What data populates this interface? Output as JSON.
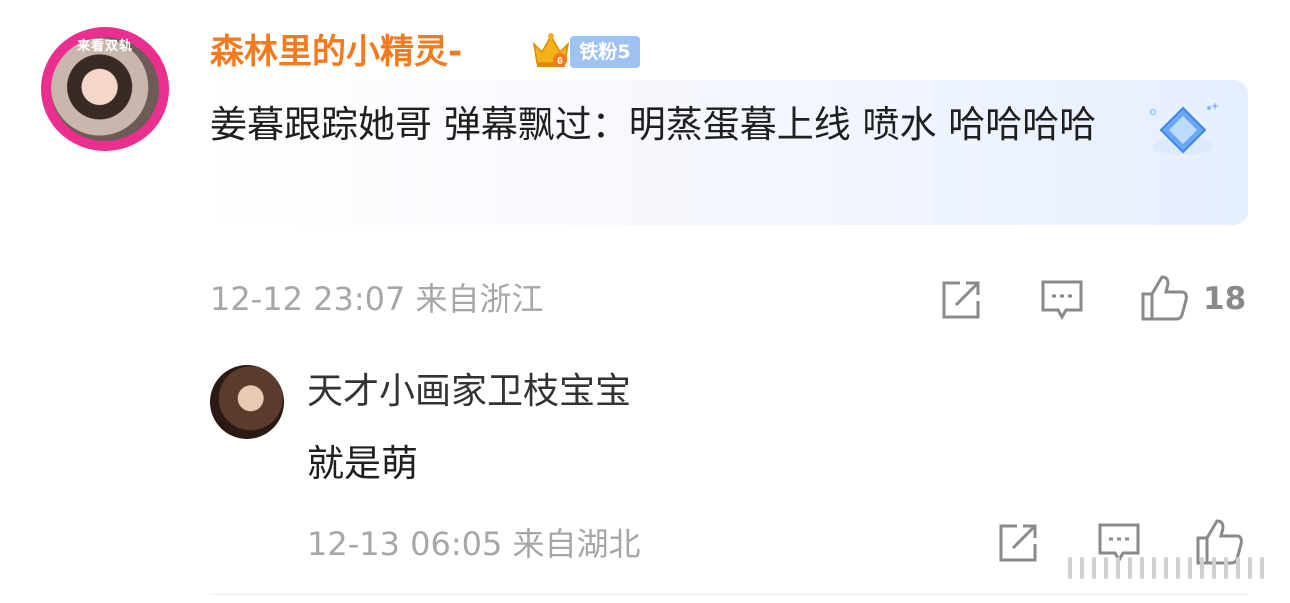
{
  "main_comment": {
    "avatar_tag": "来看双轨",
    "username": "森林里的小精灵-",
    "fan_badge": "铁粉5",
    "content": "姜暮跟踪她哥 弹幕飘过：明蒸蛋暮上线 喷水 哈哈哈哈",
    "timestamp": "12-12 23:07",
    "location": "来自浙江",
    "like_count": "18"
  },
  "reply": {
    "username": "天才小画家卫枝宝宝",
    "content": "就是萌",
    "timestamp": "12-13 06:05",
    "location": "来自湖北"
  },
  "icons": {
    "share": "share-icon",
    "comment": "comment-icon",
    "like": "thumbs-up-icon",
    "crown": "crown-icon",
    "diamond": "diamond-icon"
  },
  "colors": {
    "username": "#f47a1f",
    "fan_badge": "#9ec2f2",
    "avatar_ring": "#ea2f8e",
    "meta_text": "#a7a7a7",
    "icon": "#8a8a8a"
  }
}
